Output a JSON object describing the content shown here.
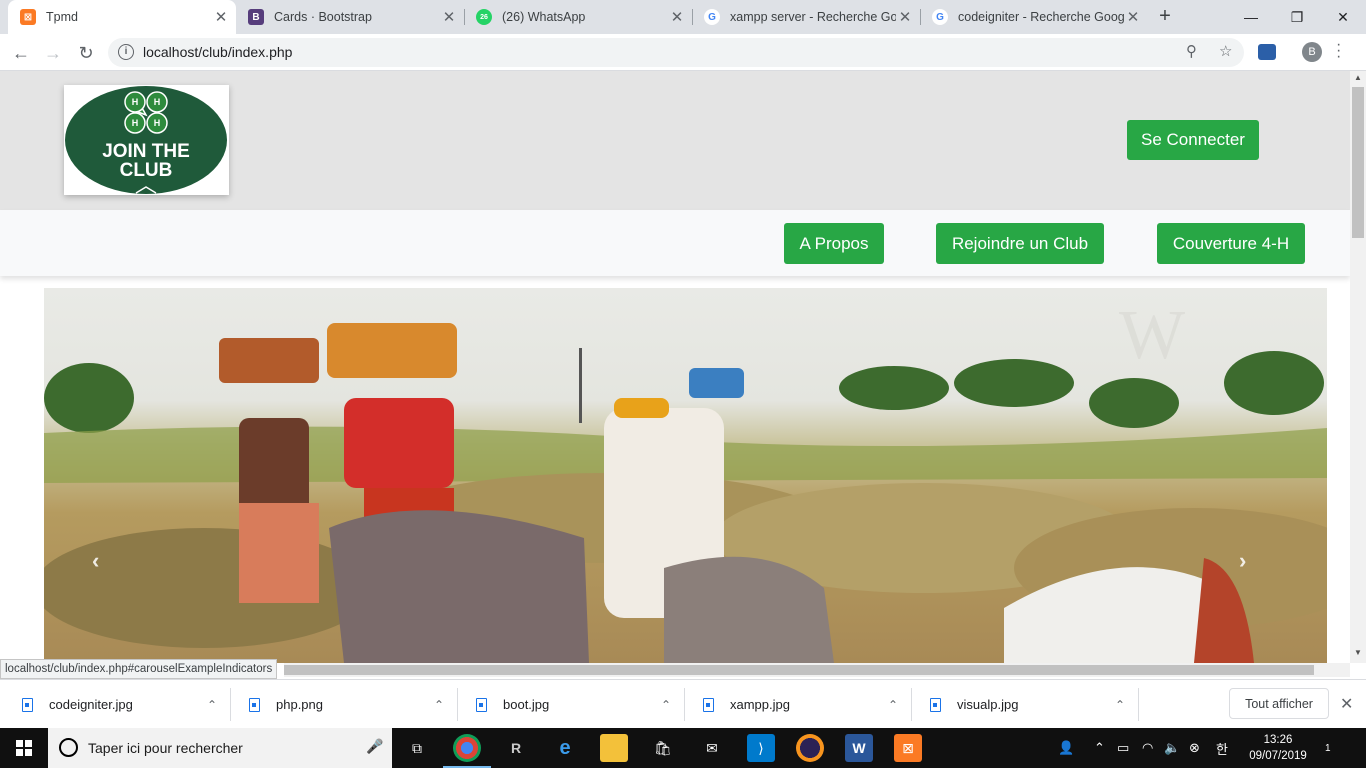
{
  "browser": {
    "tabs": [
      {
        "title": "Tpmd",
        "favicon": "xampp-icon",
        "active": true
      },
      {
        "title": "Cards · Bootstrap",
        "favicon": "bootstrap-icon"
      },
      {
        "title": "(26) WhatsApp",
        "favicon": "whatsapp-icon",
        "badge": "26"
      },
      {
        "title": "xampp server - Recherche Goo",
        "favicon": "google-icon"
      },
      {
        "title": "codeigniter - Recherche Googl",
        "favicon": "google-icon"
      }
    ],
    "url": "localhost/club/index.php",
    "profile_initial": "B",
    "status_url": "localhost/club/index.php#carouselExampleIndicators"
  },
  "site": {
    "logo_text": "JOIN THE CLUB",
    "connect_button": "Se Connecter",
    "nav": [
      {
        "label": "A Propos"
      },
      {
        "label": "Rejoindre un Club"
      },
      {
        "label": "Couverture 4-H"
      }
    ],
    "brand_color": "#28a745"
  },
  "downloads": {
    "items": [
      {
        "name": "codeigniter.jpg"
      },
      {
        "name": "php.png"
      },
      {
        "name": "boot.jpg"
      },
      {
        "name": "xampp.jpg"
      },
      {
        "name": "visualp.jpg"
      }
    ],
    "show_all": "Tout afficher"
  },
  "taskbar": {
    "search_placeholder": "Taper ici pour rechercher",
    "time": "13:26",
    "date": "09/07/2019",
    "notifications": "1"
  }
}
